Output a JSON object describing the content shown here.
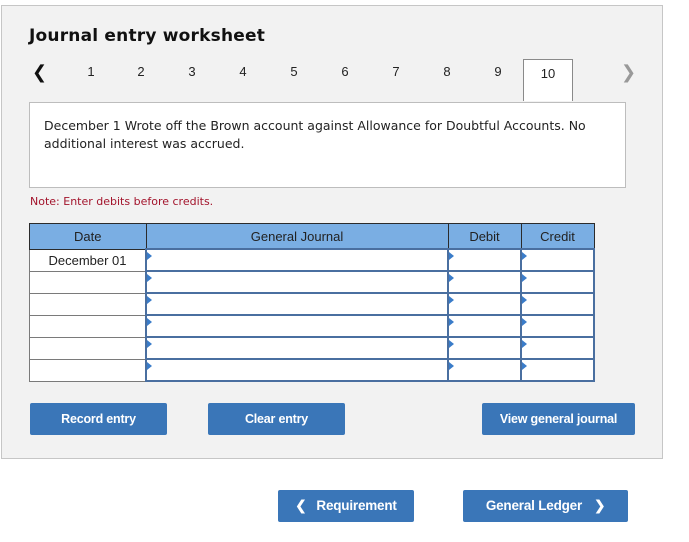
{
  "worksheet": {
    "title": "Journal entry worksheet",
    "tabs": [
      "1",
      "2",
      "3",
      "4",
      "5",
      "6",
      "7",
      "8",
      "9",
      "10"
    ],
    "active_tab": "10",
    "prev_icon": "‹",
    "next_icon": "›",
    "description": "December 1 Wrote off the Brown account against Allowance for Doubtful Accounts. No additional interest was accrued.",
    "note": "Note: Enter debits before credits."
  },
  "table": {
    "headers": {
      "date": "Date",
      "journal": "General Journal",
      "debit": "Debit",
      "credit": "Credit"
    },
    "rows": [
      {
        "date": "December 01",
        "account": "",
        "debit": "",
        "credit": ""
      },
      {
        "date": "",
        "account": "",
        "debit": "",
        "credit": ""
      },
      {
        "date": "",
        "account": "",
        "debit": "",
        "credit": ""
      },
      {
        "date": "",
        "account": "",
        "debit": "",
        "credit": ""
      },
      {
        "date": "",
        "account": "",
        "debit": "",
        "credit": ""
      },
      {
        "date": "",
        "account": "",
        "debit": "",
        "credit": ""
      }
    ]
  },
  "buttons": {
    "record": "Record entry",
    "clear": "Clear entry",
    "view": "View general journal",
    "requirement": "Requirement",
    "ledger": "General Ledger"
  },
  "colors": {
    "accent": "#3a76b8",
    "header": "#7aaee3",
    "note": "#a3142c"
  }
}
